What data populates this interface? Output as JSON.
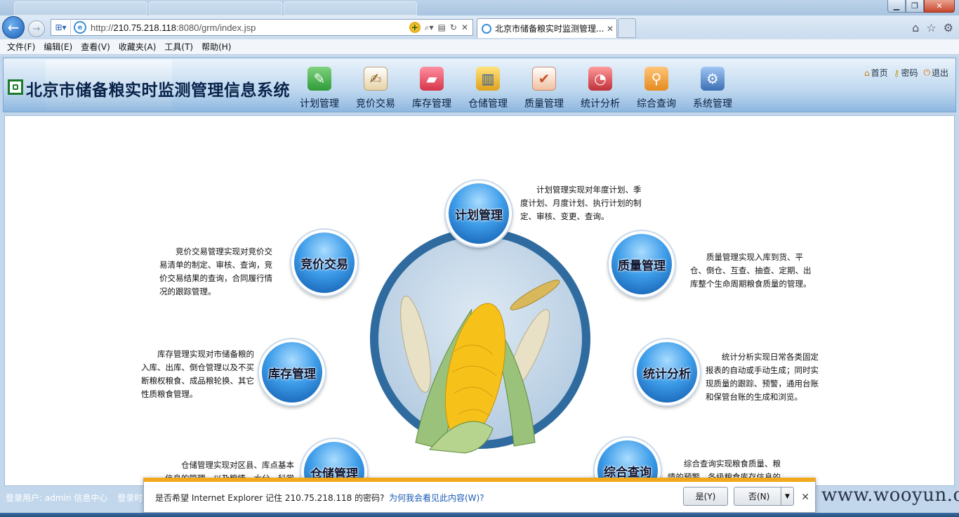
{
  "browser": {
    "url_prefix": "http://",
    "url_host": "210.75.218.118",
    "url_rest": ":8080/grm/index.jsp",
    "tab_title": "北京市储备粮实时监测管理...",
    "menu": [
      "文件(F)",
      "编辑(E)",
      "查看(V)",
      "收藏夹(A)",
      "工具(T)",
      "帮助(H)"
    ]
  },
  "header": {
    "system_title": "北京市储备粮实时监测管理信息系统",
    "nav": [
      {
        "label": "计划管理",
        "icon": "plan-icon",
        "color": "#2f9b3a"
      },
      {
        "label": "竞价交易",
        "icon": "trade-icon",
        "color": "#c9a15a"
      },
      {
        "label": "库存管理",
        "icon": "inventory-icon",
        "color": "#d8344a"
      },
      {
        "label": "仓储管理",
        "icon": "warehouse-icon",
        "color": "#e0a21a"
      },
      {
        "label": "质量管理",
        "icon": "quality-icon",
        "color": "#c4542a"
      },
      {
        "label": "统计分析",
        "icon": "statistics-icon",
        "color": "#c0303a"
      },
      {
        "label": "综合查询",
        "icon": "query-icon",
        "color": "#e58b1e"
      },
      {
        "label": "系统管理",
        "icon": "system-icon",
        "color": "#3a6fb5"
      }
    ],
    "links": {
      "home": "首页",
      "password": "密码",
      "logout": "退出"
    }
  },
  "modules": {
    "plan": {
      "title": "计划管理",
      "desc": "计划管理实现对年度计划、季度计划、月度计划、执行计划的制定、审核、变更、查询。"
    },
    "trade": {
      "title": "竞价交易",
      "desc": "竞价交易管理实现对竞价交易清单的制定、审核、查询，竞价交易结果的查询，合同履行情况的跟踪管理。"
    },
    "quality": {
      "title": "质量管理",
      "desc": "质量管理实现入库到货、平仓、倒仓、互查、抽查、定期、出库整个生命周期粮食质量的管理。"
    },
    "inventory": {
      "title": "库存管理",
      "desc": "库存管理实现对市储备粮的入库、出库、倒仓管理以及不买断粮权粮食、成品粮轮换、其它性质粮食管理。"
    },
    "statistics": {
      "title": "统计分析",
      "desc": "统计分析实现日常各类固定报表的自动或手动生成；同时实现质量的跟踪、预警，通用台账和保管台账的生成和浏览。"
    },
    "warehouse": {
      "title": "仓储管理",
      "desc": "仓储管理实现对区县、库点基本信息的管理，以及粮情、水分、科学保粮管理和规范化检查管理。"
    },
    "query": {
      "title": "综合查询",
      "desc": "综合查询实现粮食质量、粮情的预警，各级粮食库存信息的查询；并对库点进行视频监控。"
    }
  },
  "status": {
    "login_user": "登录用户: admin 信息中心",
    "login_time": "登录时"
  },
  "password_bar": {
    "question": "是否希望 Internet Explorer 记住 210.75.218.118 的密码?",
    "why_link": "为何我会看见此内容(W)?",
    "yes": "是(Y)",
    "no": "否(N)"
  },
  "watermark": "www.wooyun.org"
}
